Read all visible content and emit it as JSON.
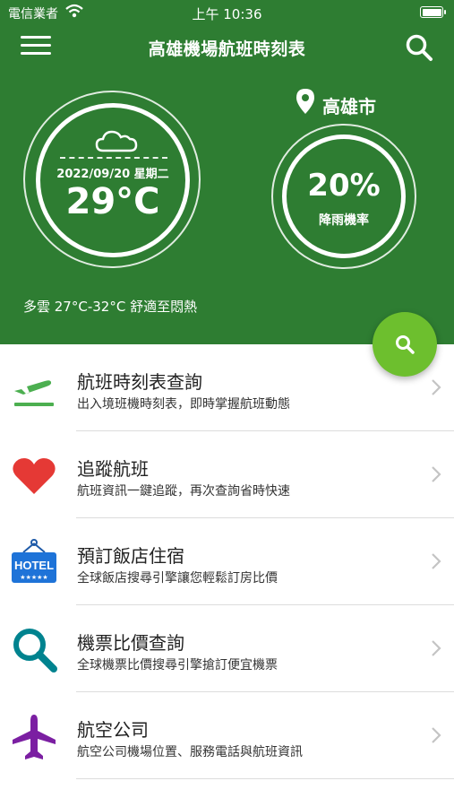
{
  "status": {
    "carrier": "電信業者",
    "time": "上午 10:36"
  },
  "header": {
    "title": "高雄機場航班時刻表"
  },
  "weather": {
    "date": "2022/09/20 星期二",
    "temperature": "29°C",
    "summary": "多雲 27°C-32°C 舒適至悶熱",
    "icon": "cloud-icon"
  },
  "location": {
    "city": "高雄市"
  },
  "rain": {
    "value": "20%",
    "label": "降雨機率"
  },
  "colors": {
    "header_bg": "#2e7d32",
    "fab": "#6dbf2e"
  },
  "list": {
    "items": [
      {
        "label": "航班時刻表查詢",
        "desc": "出入境班機時刻表，即時掌握航班動態",
        "icon": "airplane-departure-icon"
      },
      {
        "label": "追蹤航班",
        "desc": "航班資訊一鍵追蹤，再次查詢省時快速",
        "icon": "heart-icon"
      },
      {
        "label": "預訂飯店住宿",
        "desc": "全球飯店搜尋引擎讓您輕鬆訂房比價",
        "icon": "hotel-sign-icon"
      },
      {
        "label": "機票比價查詢",
        "desc": "全球機票比價搜尋引擎搶訂便宜機票",
        "icon": "magnifier-icon"
      },
      {
        "label": "航空公司",
        "desc": "航空公司機場位置、服務電話與航班資訊",
        "icon": "airplane-icon"
      }
    ]
  }
}
